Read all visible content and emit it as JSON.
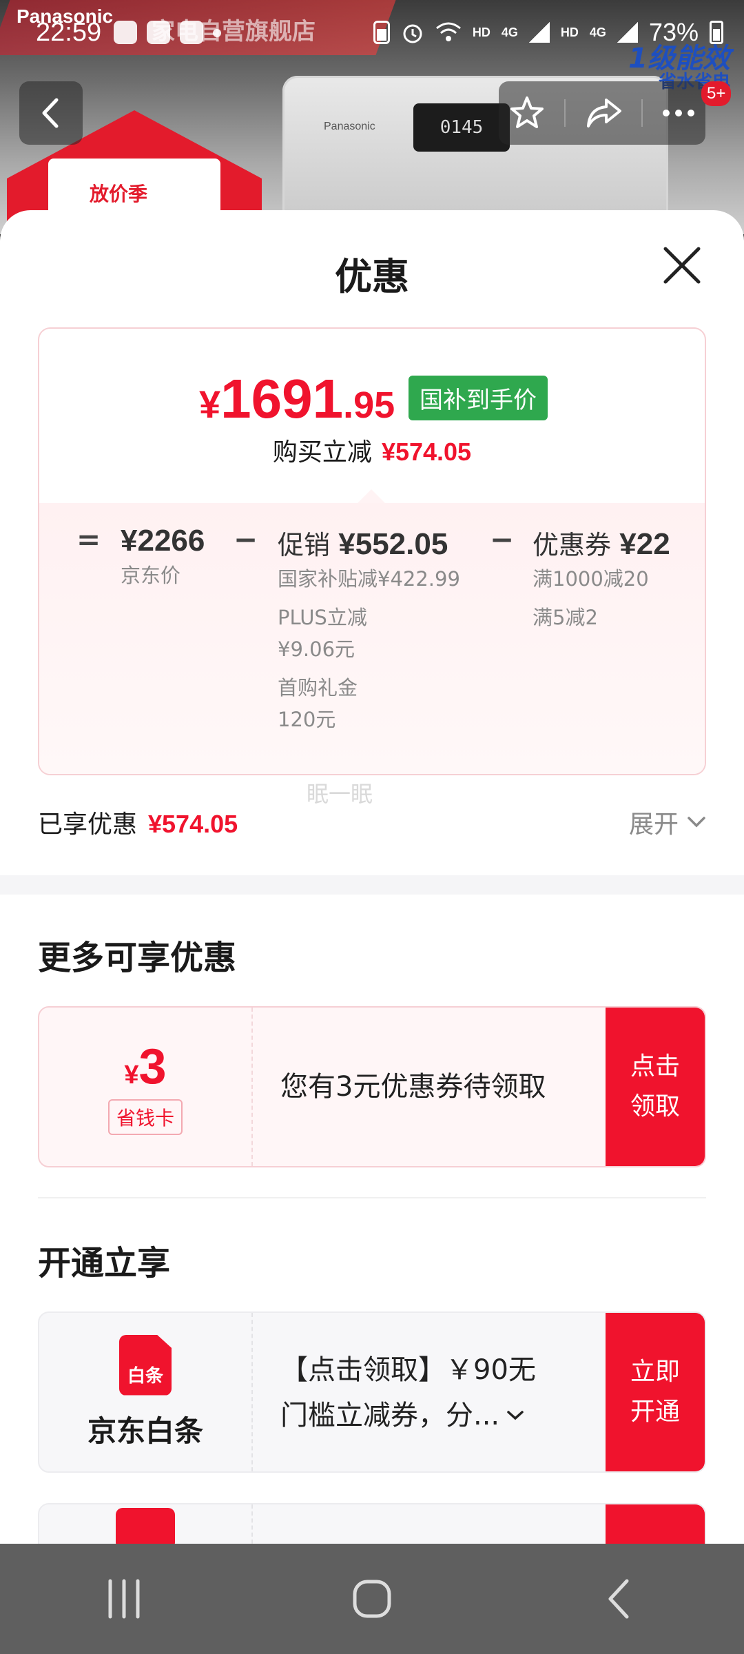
{
  "status_bar": {
    "time": "22:59",
    "battery": "73%",
    "net1": "HD",
    "net2": "4G",
    "net3": "HD",
    "net4": "4G"
  },
  "banner": {
    "brand": "Panasonic",
    "shop": "家电自营旗舰店",
    "badge": "放价季",
    "energy": "1级能效",
    "energy_sub": "省水省电",
    "display": "0145"
  },
  "nav": {
    "badge_count": "5+"
  },
  "sheet": {
    "title": "优惠",
    "price": {
      "yen": "¥",
      "integer": "1691",
      "decimal": ".95",
      "tag": "国补到手价"
    },
    "reduce_label": "购买立减",
    "reduce_amount": "¥574.05",
    "breakdown": {
      "op_eq": "=",
      "op_minus": "−",
      "jd_price": {
        "value": "¥2266",
        "label": "京东价"
      },
      "promo": {
        "label": "促销",
        "value": "¥552.05",
        "items": [
          "国家补贴减¥422.99",
          "PLUS立减",
          "¥9.06元",
          "首购礼金",
          "120元"
        ]
      },
      "coupon": {
        "label": "优惠券",
        "value": "¥22",
        "items": [
          "满1000减20",
          "满5减2"
        ]
      }
    },
    "ghost_text": "眠一眠",
    "enjoyed_label": "已享优惠",
    "enjoyed_amount": "¥574.05",
    "expand_label": "展开",
    "more_title": "更多可享优惠",
    "coupon_offer": {
      "yen": "¥",
      "value": "3",
      "tag": "省钱卡",
      "text": "您有3元优惠券待领取",
      "cta_line1": "点击",
      "cta_line2": "领取"
    },
    "open_title": "开通立享",
    "baitiao_offer": {
      "icon_text": "白条",
      "name": "京东白条",
      "text_line1": "【点击领取】￥90无",
      "text_line2": "门槛立减券，分...",
      "cta_line1": "立即",
      "cta_line2": "开通"
    }
  },
  "colors": {
    "accent_red": "#f0132d",
    "subsidy_green": "#2fa84e"
  }
}
